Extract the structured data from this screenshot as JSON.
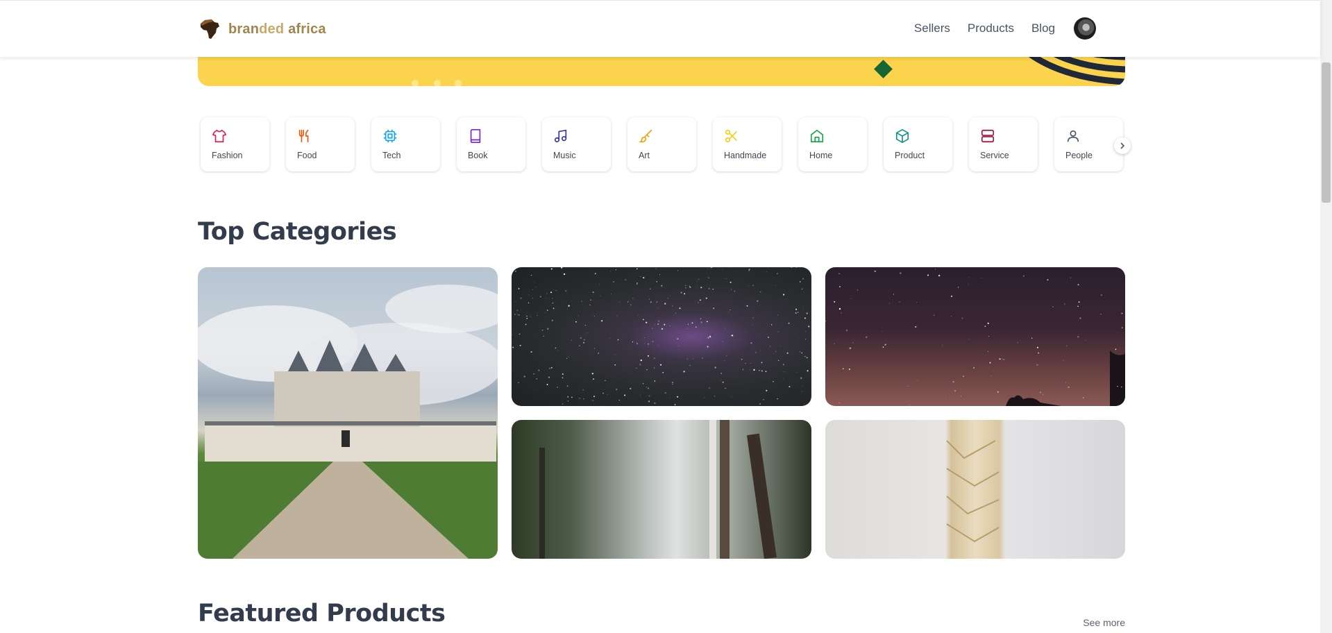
{
  "brand": {
    "name_part1": "bran",
    "name_part2": "ded",
    "name_part3": " africa"
  },
  "nav": {
    "items": [
      "Sellers",
      "Products",
      "Blog"
    ]
  },
  "categories": [
    {
      "label": "Fashion",
      "icon": "shirt-icon",
      "color": "#e11d48"
    },
    {
      "label": "Food",
      "icon": "utensils-icon",
      "color": "#ea580c"
    },
    {
      "label": "Tech",
      "icon": "cpu-icon",
      "color": "#0ea5e9"
    },
    {
      "label": "Book",
      "icon": "book-icon",
      "color": "#7e22ce"
    },
    {
      "label": "Music",
      "icon": "music-icon",
      "color": "#3730a3"
    },
    {
      "label": "Art",
      "icon": "brush-icon",
      "color": "#f59e0b"
    },
    {
      "label": "Handmade",
      "icon": "scissors-icon",
      "color": "#facc15"
    },
    {
      "label": "Home",
      "icon": "home-icon",
      "color": "#16a34a"
    },
    {
      "label": "Product",
      "icon": "box-icon",
      "color": "#0d9488"
    },
    {
      "label": "Service",
      "icon": "server-icon",
      "color": "#9f1239"
    },
    {
      "label": "People",
      "icon": "user-icon",
      "color": "#475569"
    }
  ],
  "sections": {
    "top_categories": "Top Categories",
    "featured_products": "Featured Products",
    "see_more": "See more"
  },
  "colors": {
    "banner": "#fcd34d",
    "diamond": "#166534",
    "heading": "#333c4d"
  }
}
